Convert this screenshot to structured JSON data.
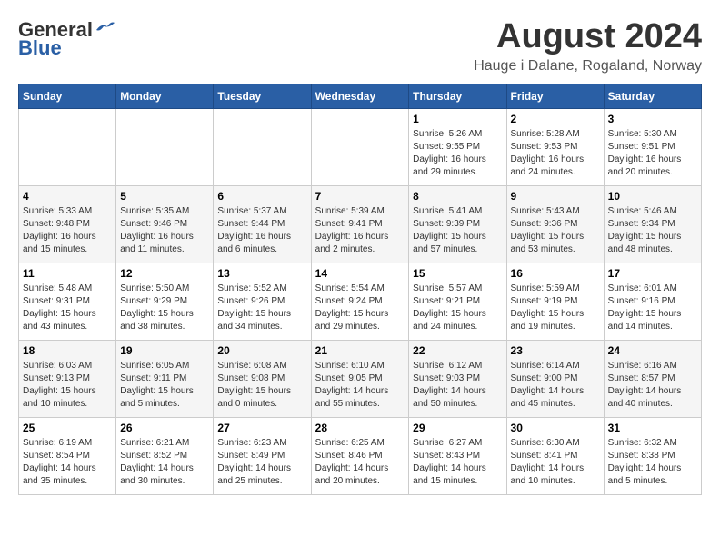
{
  "header": {
    "logo_line1": "General",
    "logo_line2": "Blue",
    "month_title": "August 2024",
    "location": "Hauge i Dalane, Rogaland, Norway"
  },
  "days_of_week": [
    "Sunday",
    "Monday",
    "Tuesday",
    "Wednesday",
    "Thursday",
    "Friday",
    "Saturday"
  ],
  "weeks": [
    [
      {
        "day": "",
        "info": ""
      },
      {
        "day": "",
        "info": ""
      },
      {
        "day": "",
        "info": ""
      },
      {
        "day": "",
        "info": ""
      },
      {
        "day": "1",
        "info": "Sunrise: 5:26 AM\nSunset: 9:55 PM\nDaylight: 16 hours\nand 29 minutes."
      },
      {
        "day": "2",
        "info": "Sunrise: 5:28 AM\nSunset: 9:53 PM\nDaylight: 16 hours\nand 24 minutes."
      },
      {
        "day": "3",
        "info": "Sunrise: 5:30 AM\nSunset: 9:51 PM\nDaylight: 16 hours\nand 20 minutes."
      }
    ],
    [
      {
        "day": "4",
        "info": "Sunrise: 5:33 AM\nSunset: 9:48 PM\nDaylight: 16 hours\nand 15 minutes."
      },
      {
        "day": "5",
        "info": "Sunrise: 5:35 AM\nSunset: 9:46 PM\nDaylight: 16 hours\nand 11 minutes."
      },
      {
        "day": "6",
        "info": "Sunrise: 5:37 AM\nSunset: 9:44 PM\nDaylight: 16 hours\nand 6 minutes."
      },
      {
        "day": "7",
        "info": "Sunrise: 5:39 AM\nSunset: 9:41 PM\nDaylight: 16 hours\nand 2 minutes."
      },
      {
        "day": "8",
        "info": "Sunrise: 5:41 AM\nSunset: 9:39 PM\nDaylight: 15 hours\nand 57 minutes."
      },
      {
        "day": "9",
        "info": "Sunrise: 5:43 AM\nSunset: 9:36 PM\nDaylight: 15 hours\nand 53 minutes."
      },
      {
        "day": "10",
        "info": "Sunrise: 5:46 AM\nSunset: 9:34 PM\nDaylight: 15 hours\nand 48 minutes."
      }
    ],
    [
      {
        "day": "11",
        "info": "Sunrise: 5:48 AM\nSunset: 9:31 PM\nDaylight: 15 hours\nand 43 minutes."
      },
      {
        "day": "12",
        "info": "Sunrise: 5:50 AM\nSunset: 9:29 PM\nDaylight: 15 hours\nand 38 minutes."
      },
      {
        "day": "13",
        "info": "Sunrise: 5:52 AM\nSunset: 9:26 PM\nDaylight: 15 hours\nand 34 minutes."
      },
      {
        "day": "14",
        "info": "Sunrise: 5:54 AM\nSunset: 9:24 PM\nDaylight: 15 hours\nand 29 minutes."
      },
      {
        "day": "15",
        "info": "Sunrise: 5:57 AM\nSunset: 9:21 PM\nDaylight: 15 hours\nand 24 minutes."
      },
      {
        "day": "16",
        "info": "Sunrise: 5:59 AM\nSunset: 9:19 PM\nDaylight: 15 hours\nand 19 minutes."
      },
      {
        "day": "17",
        "info": "Sunrise: 6:01 AM\nSunset: 9:16 PM\nDaylight: 15 hours\nand 14 minutes."
      }
    ],
    [
      {
        "day": "18",
        "info": "Sunrise: 6:03 AM\nSunset: 9:13 PM\nDaylight: 15 hours\nand 10 minutes."
      },
      {
        "day": "19",
        "info": "Sunrise: 6:05 AM\nSunset: 9:11 PM\nDaylight: 15 hours\nand 5 minutes."
      },
      {
        "day": "20",
        "info": "Sunrise: 6:08 AM\nSunset: 9:08 PM\nDaylight: 15 hours\nand 0 minutes."
      },
      {
        "day": "21",
        "info": "Sunrise: 6:10 AM\nSunset: 9:05 PM\nDaylight: 14 hours\nand 55 minutes."
      },
      {
        "day": "22",
        "info": "Sunrise: 6:12 AM\nSunset: 9:03 PM\nDaylight: 14 hours\nand 50 minutes."
      },
      {
        "day": "23",
        "info": "Sunrise: 6:14 AM\nSunset: 9:00 PM\nDaylight: 14 hours\nand 45 minutes."
      },
      {
        "day": "24",
        "info": "Sunrise: 6:16 AM\nSunset: 8:57 PM\nDaylight: 14 hours\nand 40 minutes."
      }
    ],
    [
      {
        "day": "25",
        "info": "Sunrise: 6:19 AM\nSunset: 8:54 PM\nDaylight: 14 hours\nand 35 minutes."
      },
      {
        "day": "26",
        "info": "Sunrise: 6:21 AM\nSunset: 8:52 PM\nDaylight: 14 hours\nand 30 minutes."
      },
      {
        "day": "27",
        "info": "Sunrise: 6:23 AM\nSunset: 8:49 PM\nDaylight: 14 hours\nand 25 minutes."
      },
      {
        "day": "28",
        "info": "Sunrise: 6:25 AM\nSunset: 8:46 PM\nDaylight: 14 hours\nand 20 minutes."
      },
      {
        "day": "29",
        "info": "Sunrise: 6:27 AM\nSunset: 8:43 PM\nDaylight: 14 hours\nand 15 minutes."
      },
      {
        "day": "30",
        "info": "Sunrise: 6:30 AM\nSunset: 8:41 PM\nDaylight: 14 hours\nand 10 minutes."
      },
      {
        "day": "31",
        "info": "Sunrise: 6:32 AM\nSunset: 8:38 PM\nDaylight: 14 hours\nand 5 minutes."
      }
    ]
  ]
}
